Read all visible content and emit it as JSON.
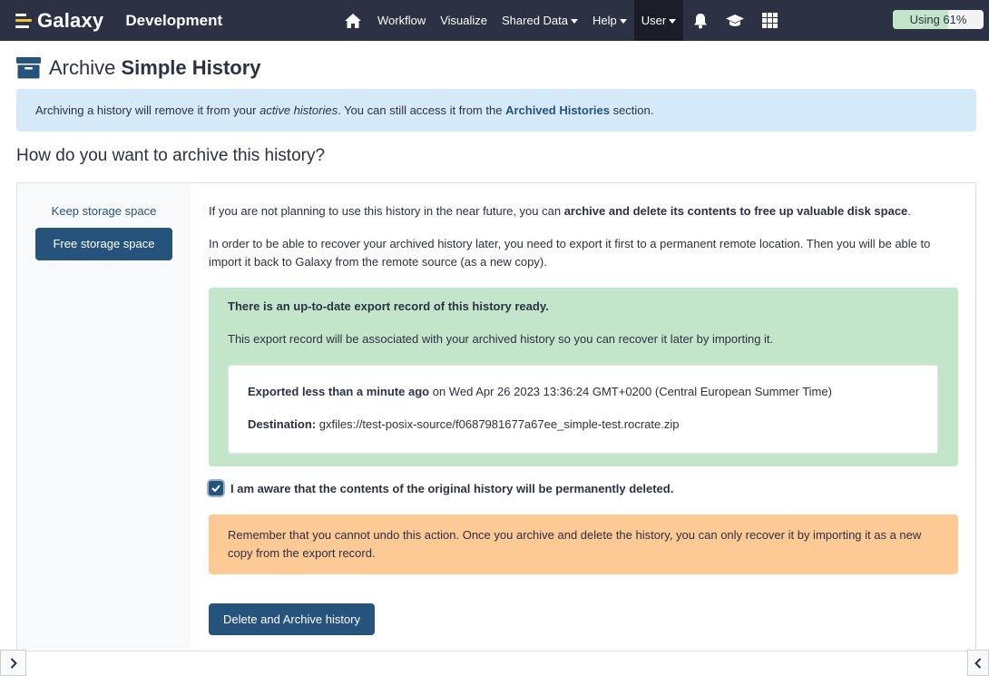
{
  "masthead": {
    "brand": "Galaxy",
    "subtitle": "Development",
    "nav": [
      {
        "label": "Workflow",
        "caret": false
      },
      {
        "label": "Visualize",
        "caret": false
      },
      {
        "label": "Shared Data",
        "caret": true
      },
      {
        "label": "Help",
        "caret": true
      },
      {
        "label": "User",
        "caret": true
      }
    ],
    "icons": [
      "home-icon",
      "bell-icon",
      "graduation-cap-icon",
      "grid-icon"
    ],
    "quota": {
      "label": "Using 61%",
      "percent": 61
    }
  },
  "page": {
    "title_prefix": "Archive",
    "title_name": "Simple History",
    "title_icon": "archive-icon",
    "info": {
      "text_before": "Archiving a history will remove it from your",
      "emphasis": "active histories",
      "text_middle": ". You can still access it from the",
      "link": "Archived Histories",
      "text_after": "section."
    },
    "question": "How do you want to archive this history?"
  },
  "tabs": {
    "keep": "Keep storage space",
    "free": "Free storage space"
  },
  "content": {
    "p1_before": "If you are not planning to use this history in the near future, you can",
    "p1_bold": "archive and delete its contents to free up valuable disk space",
    "p1_after": ".",
    "p2": "In order to be able to recover your archived history later, you need to export it first to a permanent remote location. Then you will be able to import it back to Galaxy from the remote source (as a new copy).",
    "success_title": "There is an up-to-date export record of this history ready.",
    "success_sub": "This export record will be associated with your archived history so you can recover it later by importing it.",
    "exported_label": "Exported less than a minute ago",
    "exported_date": "on Wed Apr 26 2023 13:36:24 GMT+0200 (Central European Summer Time)",
    "destination_label": "Destination:",
    "destination_value": "gxfiles://test-posix-source/f0687981677a67ee_simple-test.rocrate.zip",
    "checkbox_label": "I am aware that the contents of the original history will be permanently deleted.",
    "warning": "Remember that you cannot undo this action. Once you archive and delete the history, you can only recover it by importing it as a new copy from the export record.",
    "submit": "Delete and Archive history"
  },
  "colors": {
    "masthead": "#2c3143",
    "primary": "#25537b",
    "info_bg": "#d6e9f8",
    "success_bg": "#c3e6cb",
    "warning_bg": "#fdca96"
  }
}
